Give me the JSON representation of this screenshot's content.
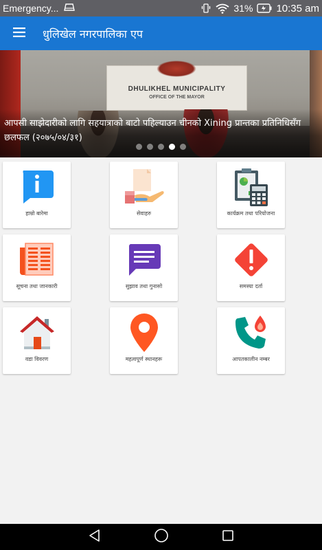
{
  "status_bar": {
    "carrier": "Emergency...",
    "battery": "31%",
    "time": "10:35 am"
  },
  "app_bar": {
    "title": "धुलिखेल नगरपालिका एप"
  },
  "banner": {
    "sign_line1": "DHULIKHEL MUNICIPALITY",
    "sign_line2": "OFFICE OF THE MAYOR",
    "caption": "आपसी साझेदारीको लागि सहयात्राको बाटो पहिल्याउन चीनको Xining प्रान्तका प्रतिनिधिसँग छलफल (२०७५/०४/३१)",
    "slide_count": 5,
    "active_slide": 4
  },
  "tiles": [
    {
      "label": "हाम्रो बारेमा",
      "icon": "info-chat-icon"
    },
    {
      "label": "सेवाहरु",
      "icon": "services-hands-icon"
    },
    {
      "label": "कार्यक्रम तथा परियोजना",
      "icon": "calculator-clipboard-icon"
    },
    {
      "label": "सूचना तथा जानकारी",
      "icon": "newspaper-icon"
    },
    {
      "label": "सुझाव तथा गुनासो",
      "icon": "message-bubble-icon"
    },
    {
      "label": "समस्या दर्ता",
      "icon": "warning-diamond-icon"
    },
    {
      "label": "वडा विवरण",
      "icon": "house-icon"
    },
    {
      "label": "महत्वपूर्ण स्थानहरू",
      "icon": "map-pin-icon"
    },
    {
      "label": "आपतकालीन नम्बर",
      "icon": "emergency-phone-icon"
    }
  ],
  "nav_bar": {
    "back": "back-triangle-icon",
    "home": "home-circle-icon",
    "recents": "recents-square-icon"
  },
  "colors": {
    "app_bar": "#1976d2",
    "status_bar": "#5f5f64",
    "background": "#f2f2f2"
  }
}
